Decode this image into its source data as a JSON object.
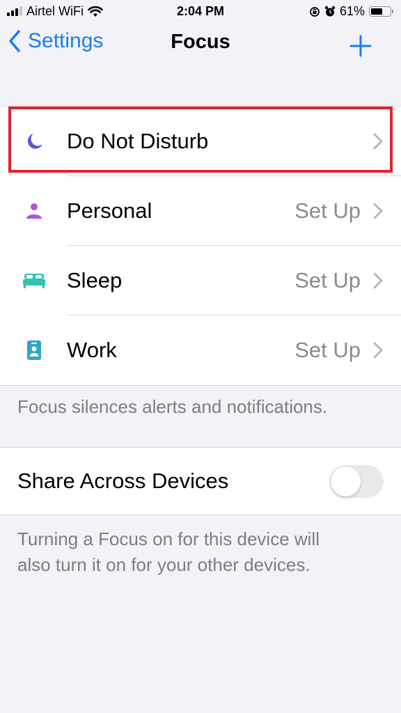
{
  "status_bar": {
    "carrier": "Airtel WiFi",
    "time": "2:04 PM",
    "battery_percent_label": "61%",
    "battery_level": 0.61,
    "icons": [
      "signal-icon",
      "wifi-icon",
      "orientation-lock-icon",
      "alarm-icon",
      "battery-icon"
    ]
  },
  "nav": {
    "back_label": "Settings",
    "title": "Focus",
    "add_icon": "plus-icon"
  },
  "focus_list": [
    {
      "label": "Do Not Disturb",
      "value": "",
      "icon": "moon-icon",
      "color": "#5856d6",
      "highlighted": true
    },
    {
      "label": "Personal",
      "value": "Set Up",
      "icon": "person-icon",
      "color": "#af52de",
      "highlighted": false
    },
    {
      "label": "Sleep",
      "value": "Set Up",
      "icon": "bed-icon",
      "color": "#30c4b5",
      "highlighted": false
    },
    {
      "label": "Work",
      "value": "Set Up",
      "icon": "id-badge-icon",
      "color": "#30a6c4",
      "highlighted": false
    }
  ],
  "focus_footer": "Focus silences alerts and notifications.",
  "share": {
    "label": "Share Across Devices",
    "enabled": false
  },
  "share_footer": {
    "line1": "Turning a Focus on for this device will",
    "line2": "also turn it on for your other devices."
  },
  "colors": {
    "accent": "#1a7cf2",
    "highlight_border": "#e3212c",
    "background": "#f2f2f7"
  }
}
